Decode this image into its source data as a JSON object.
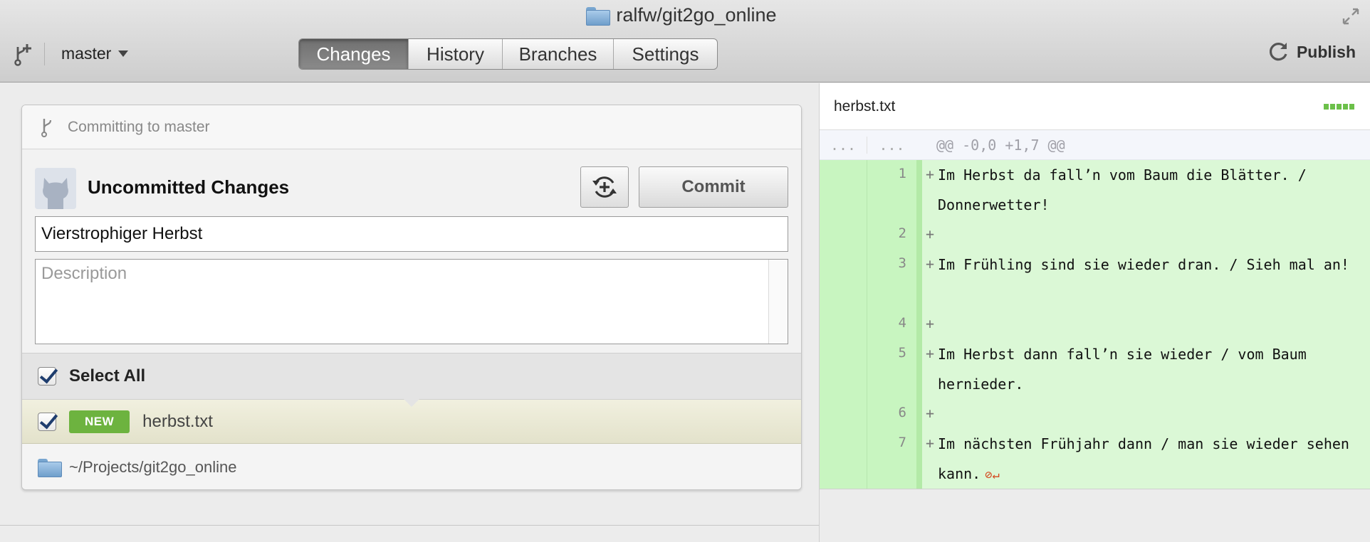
{
  "window": {
    "title": "ralfw/git2go_online"
  },
  "toolbar": {
    "branch": "master",
    "tabs": [
      {
        "label": "Changes",
        "active": true
      },
      {
        "label": "History",
        "active": false
      },
      {
        "label": "Branches",
        "active": false
      },
      {
        "label": "Settings",
        "active": false
      }
    ],
    "publish_label": "Publish"
  },
  "commit_panel": {
    "committing_to": "Committing to master",
    "heading": "Uncommitted Changes",
    "commit_button": "Commit",
    "summary_value": "Vierstrophiger Herbst",
    "description_placeholder": "Description",
    "select_all_label": "Select All",
    "files": [
      {
        "badge": "NEW",
        "name": "herbst.txt",
        "checked": true
      }
    ],
    "path": "~/Projects/git2go_online"
  },
  "diff": {
    "file_name": "herbst.txt",
    "hunk_gutter": "...",
    "hunk_header": "@@ -0,0 +1,7 @@",
    "lines": [
      {
        "num": "1",
        "sign": "+",
        "text": "Im Herbst da fall’n vom Baum die Blätter. / Donnerwetter!"
      },
      {
        "num": "2",
        "sign": "+",
        "text": ""
      },
      {
        "num": "3",
        "sign": "+",
        "text": "Im Frühling sind sie wieder dran. / Sieh mal an!"
      },
      {
        "num": "4",
        "sign": "+",
        "text": ""
      },
      {
        "num": "5",
        "sign": "+",
        "text": "Im Herbst dann fall’n sie wieder / vom Baum hernieder."
      },
      {
        "num": "6",
        "sign": "+",
        "text": ""
      },
      {
        "num": "7",
        "sign": "+",
        "text": "Im nächsten Frühjahr dann / man sie wieder sehen kann."
      }
    ],
    "no_newline_icon": "no-newline-icon",
    "colors": {
      "added_bg": "#dbf8d6",
      "added_gutter": "#c8f5c0",
      "badge_green": "#6db33f"
    }
  }
}
